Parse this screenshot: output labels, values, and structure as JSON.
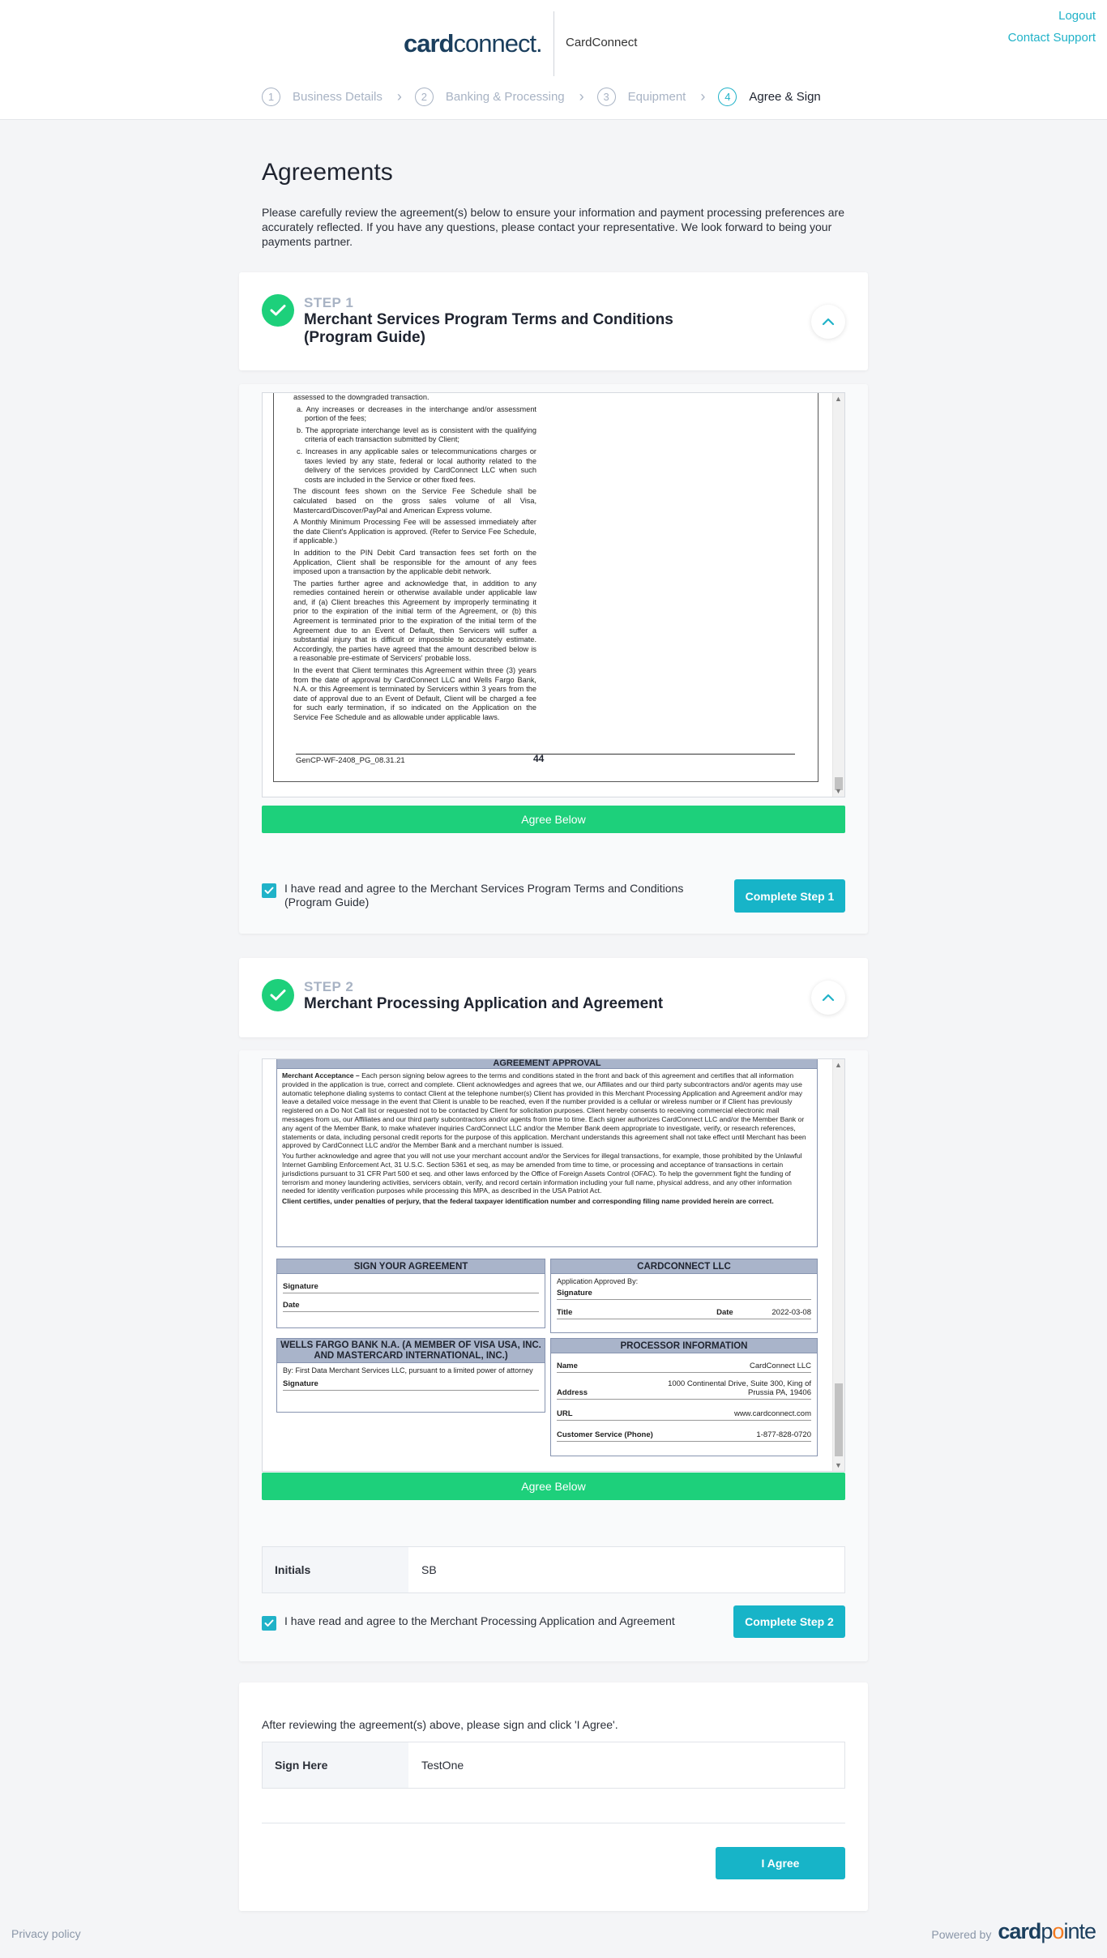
{
  "header": {
    "logo_bold": "card",
    "logo_thin": "connect.",
    "brand_name": "CardConnect",
    "logout": "Logout",
    "contact_support": "Contact Support"
  },
  "stepper": [
    {
      "num": "1",
      "label": "Business Details"
    },
    {
      "num": "2",
      "label": "Banking & Processing"
    },
    {
      "num": "3",
      "label": "Equipment"
    },
    {
      "num": "4",
      "label": "Agree & Sign"
    }
  ],
  "page": {
    "title": "Agreements",
    "intro": "Please carefully review the agreement(s) below to ensure your information and payment processing preferences are accurately reflected. If you have any questions, please contact your representative. We look forward to being your payments partner."
  },
  "step1": {
    "label": "STEP 1",
    "title": "Merchant Services Program Terms and Conditions (Program Guide)",
    "doc": {
      "lines": [
        "assessed to the downgraded transaction.",
        "a. Any increases or decreases in the interchange and/or assessment portion of the fees;",
        "b. The appropriate interchange level as is consistent with the qualifying criteria of each transaction submitted by Client;",
        "c. Increases in any applicable sales or telecommunications charges or taxes levied by any state, federal or local authority related to the delivery of the services provided by CardConnect LLC when such costs are included in the Service or other fixed fees.",
        "The discount fees shown on the Service Fee Schedule shall be calculated based on the gross sales volume of all Visa, Mastercard/Discover/PayPal and American Express volume.",
        "A Monthly Minimum Processing Fee will be assessed immediately after the date Client's Application is approved. (Refer to Service Fee Schedule, if applicable.)",
        "In addition to the PIN Debit Card transaction fees set forth on the Application, Client shall be responsible for the amount of any fees imposed upon a transaction by the applicable debit network.",
        "The parties further agree and acknowledge that, in addition to any remedies contained herein or otherwise available under applicable law and, if (a) Client breaches this Agreement by improperly terminating it prior to the expiration of the initial term of the Agreement, or (b) this Agreement is terminated prior to the expiration of the initial term of the Agreement due to an Event of Default, then Servicers will suffer a substantial injury that is difficult or impossible to accurately estimate. Accordingly, the parties have agreed that the amount described below is a reasonable pre-estimate of Servicers' probable loss.",
        "In the event that Client terminates this Agreement within three (3) years from the date of approval by CardConnect LLC and Wells Fargo Bank, N.A. or this Agreement is terminated by Servicers within 3 years from the date of approval due to an Event of Default, Client will be charged a fee for such early termination, if so indicated on the Application on the Service Fee Schedule and as allowable under applicable laws."
      ],
      "footer_code": "GenCP-WF-2408_PG_08.31.21",
      "page_number": "44"
    },
    "agree_below": "Agree Below",
    "checkbox_label": "I have read and agree to the Merchant Services Program Terms and Conditions (Program Guide)",
    "complete_button": "Complete Step 1"
  },
  "step2": {
    "label": "STEP 2",
    "title": "Merchant Processing Application and Agreement",
    "doc": {
      "approval_header": "AGREEMENT APPROVAL",
      "acceptance_lead": "Merchant Acceptance –",
      "acceptance_text": "Each person signing below agrees to the terms and conditions stated in the front and back of this agreement and certifies that all information provided in the application is true, correct and complete. Client acknowledges and agrees that we, our Affiliates and our third party subcontractors and/or agents may use automatic telephone dialing systems to contact Client at the telephone number(s) Client has provided in this Merchant Processing Application and Agreement and/or may leave a detailed voice message in the event that Client is unable to be reached, even if the number provided is a cellular or wireless number or if Client has previously registered on a Do Not Call list or requested not to be contacted by Client for solicitation purposes. Client hereby consents to receiving commercial electronic mail messages from us, our Affiliates and our third party subcontractors and/or agents from time to time. Each signer authorizes CardConnect LLC and/or the Member Bank or any agent of the Member Bank, to make whatever inquiries CardConnect LLC and/or the Member Bank deem appropriate to investigate, verify, or research references, statements or data, including personal credit reports for the purpose of this application. Merchant understands this agreement shall not take effect until Merchant has been approved by CardConnect LLC and/or the Member Bank and a merchant number is issued.",
      "usage_text": "You further acknowledge and agree that you will not use your merchant account and/or the Services for illegal transactions, for example, those prohibited by the Unlawful Internet Gambling Enforcement Act, 31 U.S.C. Section 5361 et seq, as may be amended from time to time, or processing and acceptance of transactions in certain jurisdictions pursuant to 31 CFR Part 500 et seq. and other laws enforced by the Office of Foreign Assets Control (OFAC). To help the government fight the funding of terrorism and money laundering activities, servicers obtain, verify, and record certain information including your full name, physical address, and any other information needed for identity verification purposes while processing this MPA, as described in the USA Patriot Act.",
      "certify_text": "Client certifies, under penalties of perjury, that the federal taxpayer identification number and corresponding filing name provided herein are correct.",
      "sign_box": {
        "header": "SIGN YOUR AGREEMENT",
        "signature": "Signature",
        "date": "Date"
      },
      "cc_box": {
        "header": "CARDCONNECT LLC",
        "approved_by": "Application Approved By:",
        "signature": "Signature",
        "title": "Title",
        "date_label": "Date",
        "date_value": "2022-03-08"
      },
      "wf_box": {
        "header": "WELLS FARGO BANK N.A. (A MEMBER OF VISA USA, INC. AND MASTERCARD INTERNATIONAL, INC.)",
        "by_text": "By: First Data Merchant Services LLC, pursuant to a limited power of attorney",
        "signature": "Signature"
      },
      "proc_box": {
        "header": "PROCESSOR INFORMATION",
        "rows": [
          {
            "k": "Name",
            "v": "CardConnect LLC"
          },
          {
            "k": "Address",
            "v": "1000 Continental Drive, Suite 300, King of Prussia PA, 19406"
          },
          {
            "k": "URL",
            "v": "www.cardconnect.com"
          },
          {
            "k": "Customer Service (Phone)",
            "v": "1-877-828-0720"
          }
        ]
      }
    },
    "agree_below": "Agree Below",
    "initials_label": "Initials",
    "initials_value": "SB",
    "checkbox_label": "I have read and agree to the Merchant Processing Application and Agreement",
    "complete_button": "Complete Step 2"
  },
  "final": {
    "instruction": "After reviewing the agreement(s) above, please sign and click 'I Agree'.",
    "sign_label": "Sign Here",
    "sign_value": "TestOne",
    "agree_button": "I Agree"
  },
  "footer": {
    "privacy": "Privacy policy",
    "powered_by": "Powered by",
    "cp_card": "card",
    "cp_p": "p",
    "cp_o": "o",
    "cp_inte": "inte"
  },
  "colors": {
    "accent": "#20b2c8",
    "success": "#1dd07b",
    "brand": "#1b3f5e"
  }
}
